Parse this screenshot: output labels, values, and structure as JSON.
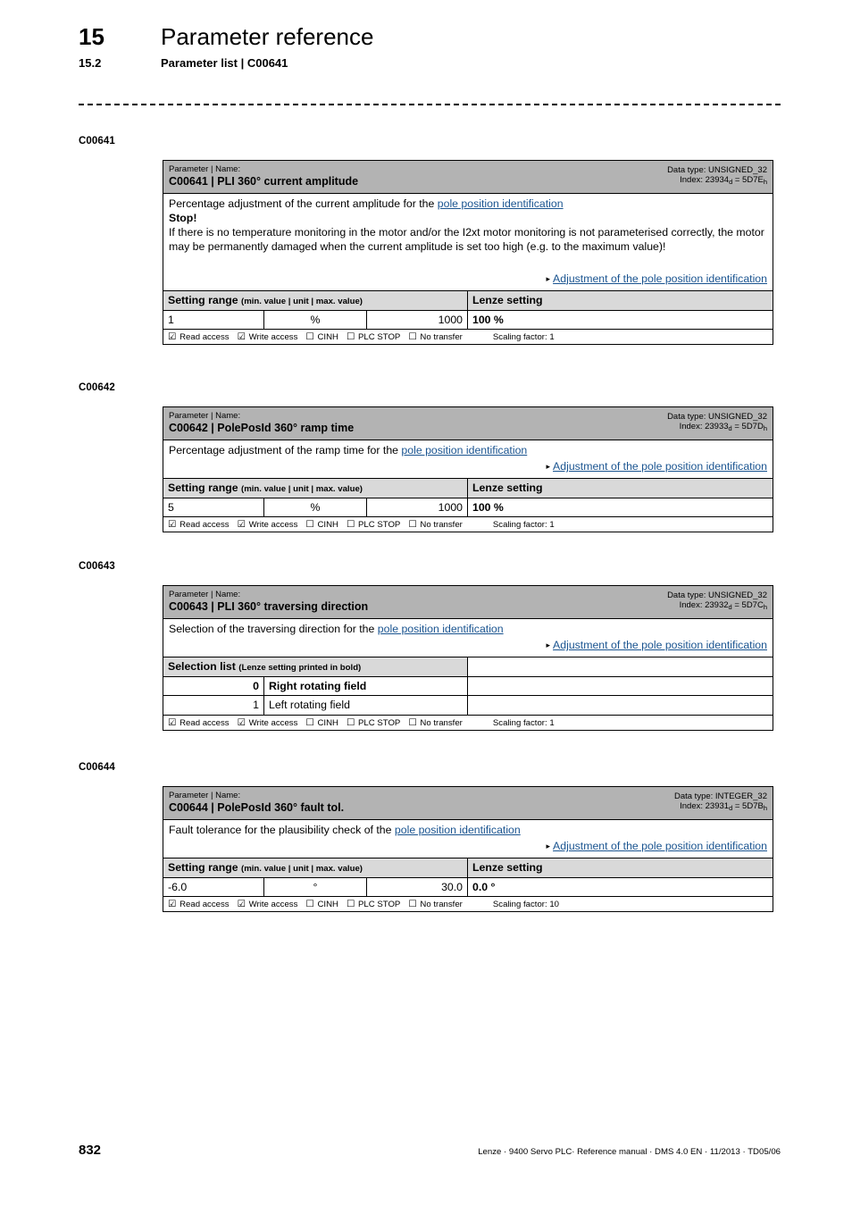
{
  "header": {
    "chapter_number": "15",
    "chapter_title": "Parameter reference",
    "section_number": "15.2",
    "section_title": "Parameter list | C00641"
  },
  "common": {
    "kicker": "Parameter | Name:",
    "setting_range_title": "Setting range",
    "setting_range_sub": "(min. value | unit | max. value)",
    "lenze_setting_title": "Lenze setting",
    "selection_list_title": "Selection list",
    "selection_list_sub": "(Lenze setting printed in bold)",
    "checked_box": "☑",
    "unchecked_box": "☐",
    "arrow": "▸",
    "read_access": "Read access",
    "write_access": "Write access",
    "cinh": "CINH",
    "plc_stop": "PLC STOP",
    "no_transfer": "No transfer",
    "link_text": "pole position identification",
    "xref_text": "Adjustment of the pole position identification",
    "link_color": "#1a5490",
    "header_band_color": "#b3b3b3",
    "subheader_color": "#d9d9d9"
  },
  "blocks": [
    {
      "code": "C00641",
      "name": "C00641 | PLI 360° current amplitude",
      "data_type": "Data type: UNSIGNED_32",
      "index_prefix": "Index: 23934",
      "index_sub1": "d",
      "index_mid": " = 5D7E",
      "index_sub2": "h",
      "desc_lead": "Percentage adjustment of the current amplitude for the ",
      "desc_link": "pole position identification",
      "warning_title": "Stop!",
      "warning_body": "If there is no temperature monitoring in the motor and/or the I2xt motor monitoring is not parameterised correctly, the motor may be permanently damaged when the current amplitude is set too high (e.g. to the maximum value)!",
      "xref": "Adjustment of the pole position identification",
      "table_type": "setting_range",
      "min_value": "1",
      "unit": "%",
      "max_value": "1000",
      "lenze_setting": "100 %",
      "scaling": "Scaling factor: 1"
    },
    {
      "code": "C00642",
      "name": "C00642 | PolePosId 360° ramp time",
      "data_type": "Data type: UNSIGNED_32",
      "index_prefix": "Index: 23933",
      "index_sub1": "d",
      "index_mid": " = 5D7D",
      "index_sub2": "h",
      "desc_lead": "Percentage adjustment of the ramp time for the ",
      "desc_link": "pole position identification",
      "warning_title": "",
      "warning_body": "",
      "xref": "Adjustment of the pole position identification",
      "table_type": "setting_range",
      "min_value": "5",
      "unit": "%",
      "max_value": "1000",
      "lenze_setting": "100 %",
      "scaling": "Scaling factor: 1"
    },
    {
      "code": "C00643",
      "name": "C00643 | PLI 360° traversing direction",
      "data_type": "Data type: UNSIGNED_32",
      "index_prefix": "Index: 23932",
      "index_sub1": "d",
      "index_mid": " = 5D7C",
      "index_sub2": "h",
      "desc_lead": "Selection of the traversing direction for the ",
      "desc_link": "pole position identification",
      "warning_title": "",
      "warning_body": "",
      "xref": "Adjustment of the pole position identification",
      "table_type": "selection_list",
      "options": [
        {
          "value": "0",
          "label": "Right rotating field",
          "is_default": true
        },
        {
          "value": "1",
          "label": "Left rotating field",
          "is_default": false
        }
      ],
      "scaling": "Scaling factor: 1"
    },
    {
      "code": "C00644",
      "name": "C00644 | PolePosId 360° fault tol.",
      "data_type": "Data type: INTEGER_32",
      "index_prefix": "Index: 23931",
      "index_sub1": "d",
      "index_mid": " = 5D7B",
      "index_sub2": "h",
      "desc_lead": "Fault tolerance for the plausibility check of the ",
      "desc_link": "pole position identification",
      "warning_title": "",
      "warning_body": "",
      "xref": "Adjustment of the pole position identification",
      "table_type": "setting_range",
      "min_value": "-6.0",
      "unit": "°",
      "max_value": "30.0",
      "lenze_setting": "0.0 °",
      "scaling": "Scaling factor: 10"
    }
  ],
  "footer": {
    "page_number": "832",
    "note": "Lenze · 9400 Servo PLC· Reference manual · DMS 4.0 EN · 11/2013 · TD05/06"
  }
}
